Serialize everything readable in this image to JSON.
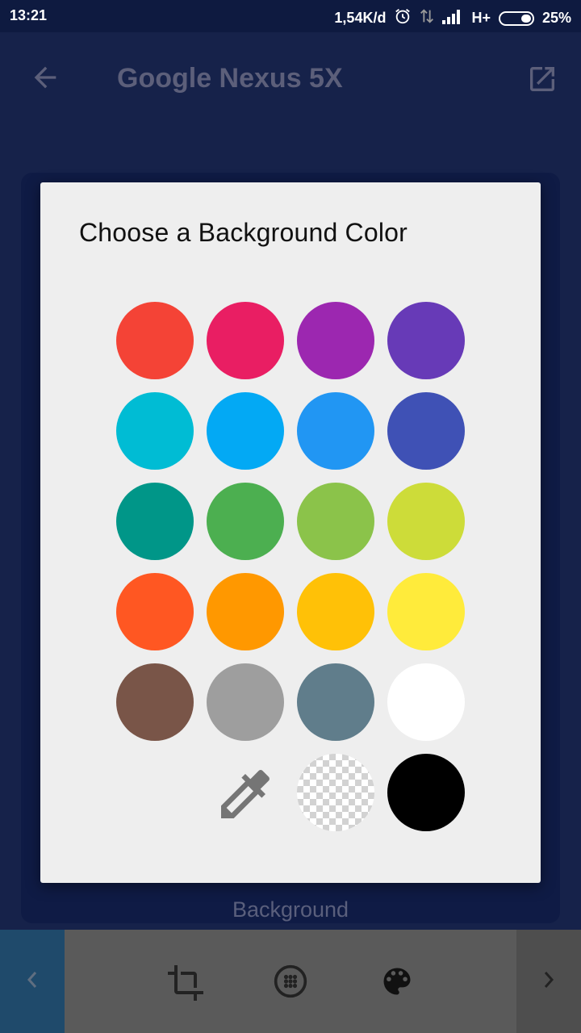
{
  "status_bar": {
    "time": "13:21",
    "net_speed": "1,54K/d",
    "network_type": "H+",
    "battery": "25%",
    "icons": [
      "alarm-icon",
      "data-transfer-icon",
      "signal-icon",
      "battery-icon"
    ]
  },
  "app_bar": {
    "title": "Google Nexus 5X",
    "back_icon": "arrow-back-icon",
    "share_icon": "open-external-icon"
  },
  "preview": {
    "label": "Background"
  },
  "toolbar": {
    "icons": [
      "chevron-left-icon",
      "crop-icon",
      "grid-icon",
      "palette-icon",
      "chevron-right-icon"
    ]
  },
  "dialog": {
    "title": "Choose a Background Color",
    "colors": [
      [
        "#f44336",
        "#e91e63",
        "#9c27b0",
        "#673ab7"
      ],
      [
        "#00bcd4",
        "#03a9f4",
        "#2196f3",
        "#3f51b5"
      ],
      [
        "#009688",
        "#4caf50",
        "#8bc34a",
        "#cddc39"
      ],
      [
        "#ff5722",
        "#ff9800",
        "#ffc107",
        "#ffeb3b"
      ],
      [
        "#795548",
        "#9e9e9e",
        "#607d8b",
        "#ffffff"
      ]
    ],
    "last_row": {
      "picker_icon": "eyedropper-icon",
      "transparent": "transparent-swatch",
      "black": "#000000"
    }
  }
}
